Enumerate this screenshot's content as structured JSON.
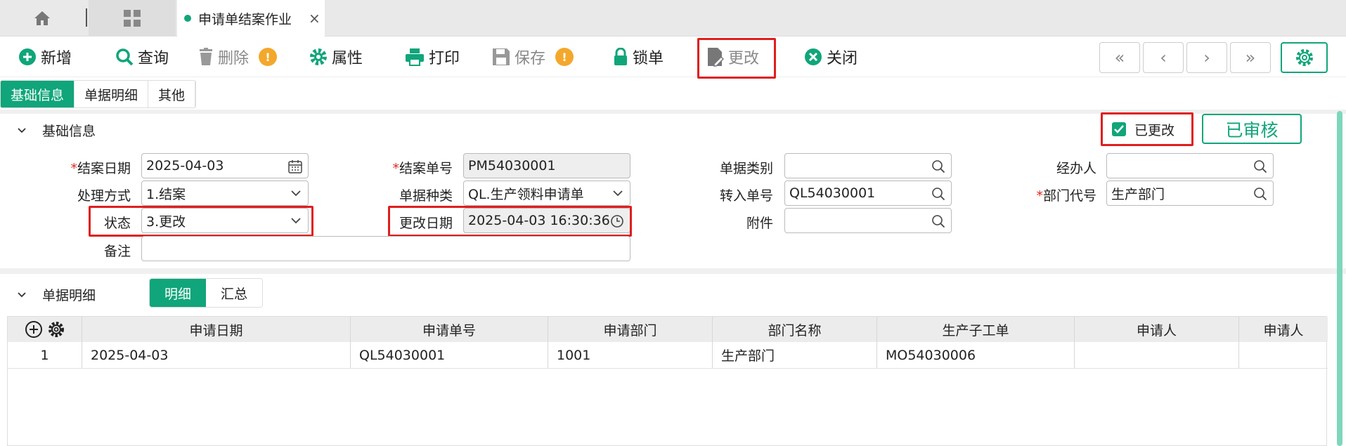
{
  "tabs": {
    "active_label": "申请单结案作业",
    "close_glyph": "×"
  },
  "toolbar": {
    "add": "新增",
    "query": "查询",
    "delete": "删除",
    "properties": "属性",
    "print": "打印",
    "save": "保存",
    "lock": "锁单",
    "modify": "更改",
    "close": "关闭",
    "warn_glyph": "!",
    "nav": [
      "«",
      "‹",
      "›",
      "»"
    ]
  },
  "section_tabs": [
    "基础信息",
    "单据明细",
    "其他"
  ],
  "basic": {
    "title": "基础信息",
    "modified_checkbox_label": "已更改",
    "approved_label": "已审核"
  },
  "form": {
    "close_date_label": "结案日期",
    "close_date_value": "2025-04-03",
    "close_no_label": "结案单号",
    "close_no_value": "PM54030001",
    "doc_category_label": "单据类别",
    "doc_category_value": "",
    "handler_label": "经办人",
    "handler_value": "",
    "method_label": "处理方式",
    "method_value": "1.结案",
    "doc_type_label": "单据种类",
    "doc_type_value": "QL.生产领料申请单",
    "transfer_no_label": "转入单号",
    "transfer_no_value": "QL54030001",
    "dept_code_label": "部门代号",
    "dept_code_value": "生产部门",
    "status_label": "状态",
    "status_value": "3.更改",
    "modify_date_label": "更改日期",
    "modify_date_value": "2025-04-03 16:30:36",
    "attach_label": "附件",
    "attach_value": "",
    "remark_label": "备注",
    "remark_value": "",
    "required_mark": "*"
  },
  "detail": {
    "title": "单据明细",
    "subtabs": [
      "明细",
      "汇总"
    ],
    "columns": [
      "申请日期",
      "申请单号",
      "申请部门",
      "部门名称",
      "生产子工单",
      "申请人",
      "申请人"
    ],
    "rows": [
      {
        "index": "1",
        "cells": [
          "2025-04-03",
          "QL54030001",
          "1001",
          "生产部门",
          "MO54030006",
          "",
          ""
        ]
      }
    ]
  },
  "colors": {
    "accent": "#10a57a",
    "highlight": "#e01e1e",
    "warning": "#f3a82c"
  }
}
